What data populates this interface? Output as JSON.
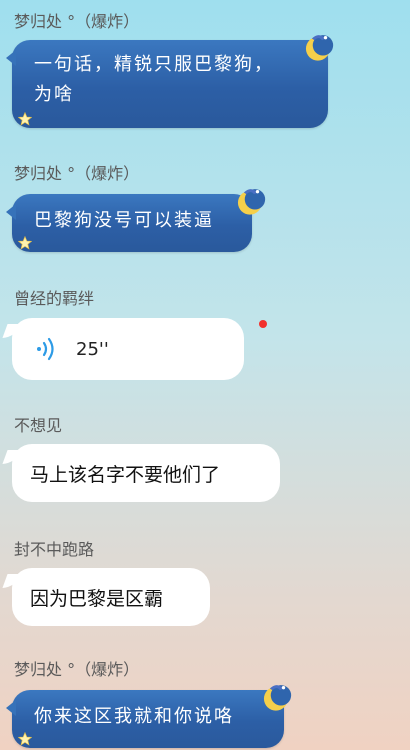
{
  "colors": {
    "theme_bubble": "#2f65ad",
    "white_bubble": "#ffffff",
    "unread_dot": "#f2302c",
    "sender_text": "#5a5a5a"
  },
  "messages": [
    {
      "sender": "梦归处 °（爆炸）",
      "type": "themed-text",
      "lines": [
        "一句话，精锐只服巴黎狗，",
        "为啥"
      ]
    },
    {
      "sender": "梦归处 °（爆炸）",
      "type": "themed-text",
      "lines": [
        "巴黎狗没号可以装逼"
      ]
    },
    {
      "sender": "曾经的羁绊",
      "type": "voice",
      "duration": "25''",
      "unread": true
    },
    {
      "sender": "不想见",
      "type": "text",
      "text": "马上该名字不要他们了"
    },
    {
      "sender": "封不中跑路",
      "type": "text",
      "text": "因为巴黎是区霸"
    },
    {
      "sender": "梦归处 °（爆炸）",
      "type": "themed-text",
      "lines": [
        "你来这区我就和你说咯"
      ]
    }
  ]
}
